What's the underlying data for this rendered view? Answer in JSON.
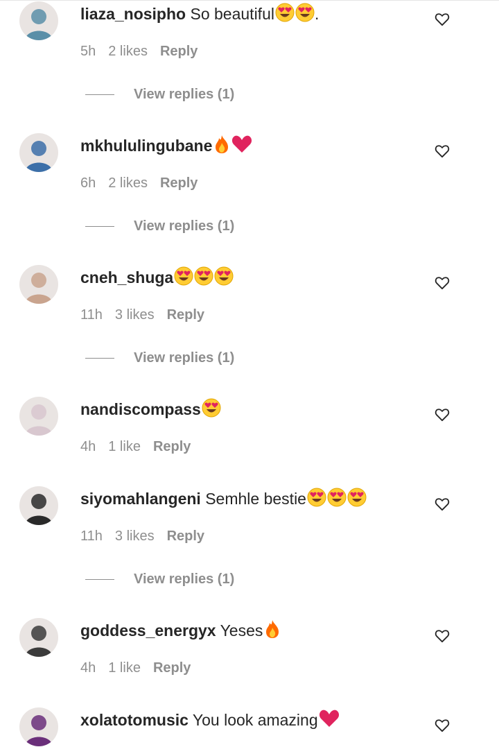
{
  "comments": [
    {
      "username": "liaza_nosipho",
      "text": "So beautiful",
      "emojis": [
        "heart-eyes",
        "heart-eyes"
      ],
      "suffix": ".",
      "time": "5h",
      "likes": "2 likes",
      "reply": "Reply",
      "view_replies": "View replies (1)",
      "avatar_color": "#5a8fa8"
    },
    {
      "username": "mkhululingubane",
      "text": "",
      "emojis": [
        "fire",
        "red-heart"
      ],
      "suffix": "",
      "time": "6h",
      "likes": "2 likes",
      "reply": "Reply",
      "view_replies": "View replies (1)",
      "avatar_color": "#3c6fa8"
    },
    {
      "username": "cneh_shuga",
      "text": "",
      "emojis": [
        "heart-eyes",
        "heart-eyes",
        "heart-eyes"
      ],
      "suffix": "",
      "time": "11h",
      "likes": "3 likes",
      "reply": "Reply",
      "view_replies": "View replies (1)",
      "avatar_color": "#c9a48e"
    },
    {
      "username": "nandiscompass",
      "text": "",
      "emojis": [
        "heart-eyes"
      ],
      "suffix": "",
      "time": "4h",
      "likes": "1 like",
      "reply": "Reply",
      "view_replies": "",
      "avatar_color": "#d8c7cf"
    },
    {
      "username": "siyomahlangeni",
      "text": "Semhle bestie",
      "emojis": [
        "heart-eyes",
        "heart-eyes",
        "heart-eyes"
      ],
      "suffix": "",
      "time": "11h",
      "likes": "3 likes",
      "reply": "Reply",
      "view_replies": "View replies (1)",
      "avatar_color": "#2a2a2a"
    },
    {
      "username": "goddess_energyx",
      "text": "Yeses",
      "emojis": [
        "fire"
      ],
      "suffix": "",
      "time": "4h",
      "likes": "1 like",
      "reply": "Reply",
      "view_replies": "",
      "avatar_color": "#3b3b3b"
    },
    {
      "username": "xolatotomusic",
      "text": "You look amazing",
      "emojis": [
        "red-heart"
      ],
      "suffix": "",
      "time": "",
      "likes": "",
      "reply": "",
      "view_replies": "",
      "avatar_color": "#6a2f7a"
    }
  ],
  "colors": {
    "meta": "#8e8e8e",
    "text": "#262626",
    "heart_red": "#e0245e",
    "emoji_yellow": "#ffcc33",
    "fire_orange": "#ff6a00"
  }
}
